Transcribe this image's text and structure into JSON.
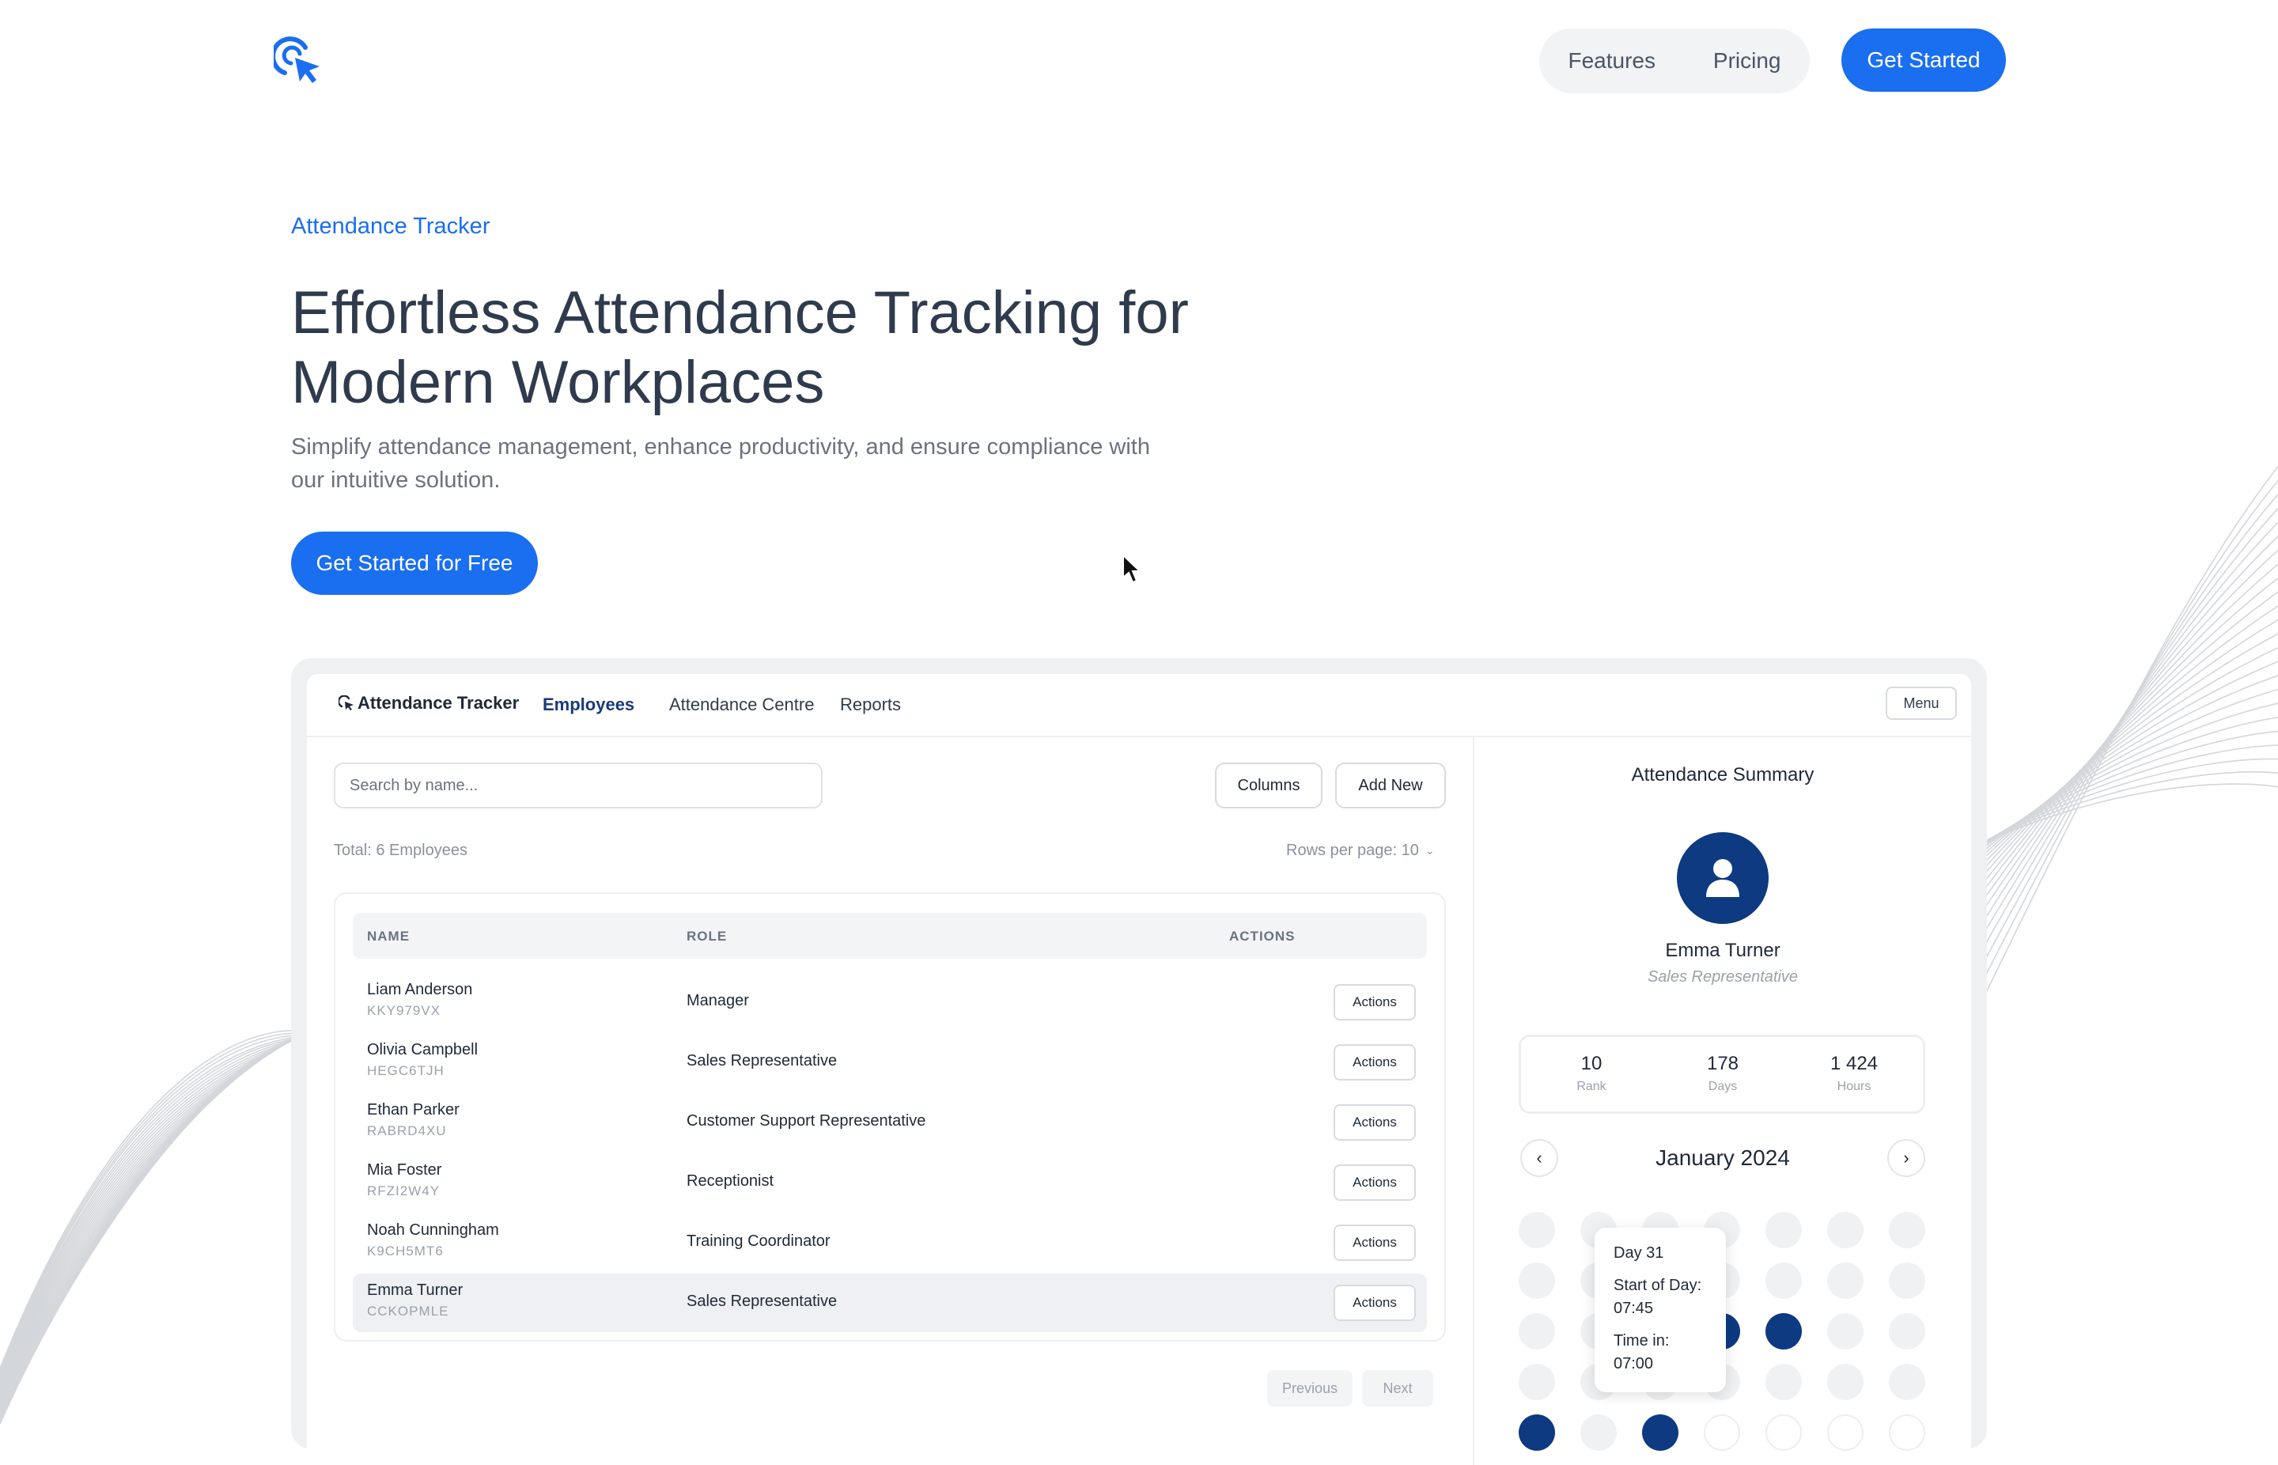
{
  "nav": {
    "links": [
      "Features",
      "Pricing"
    ],
    "cta": "Get Started"
  },
  "hero": {
    "eyebrow": "Attendance Tracker",
    "title_line1": "Effortless Attendance Tracking for",
    "title_line2": "Modern Workplaces",
    "subtitle_line1": "Simplify attendance management, enhance productivity, and ensure compliance with",
    "subtitle_line2": "our intuitive solution.",
    "cta": "Get Started for Free"
  },
  "app": {
    "brand": "Attendance Tracker",
    "tabs": [
      "Employees",
      "Attendance Centre",
      "Reports"
    ],
    "active_tab": "Employees",
    "menu": "Menu",
    "search_placeholder": "Search by name...",
    "columns_button": "Columns",
    "add_new_button": "Add New",
    "total": "Total: 6 Employees",
    "rows_per_page": "Rows per page: 10",
    "table": {
      "headers": [
        "NAME",
        "ROLE",
        "ACTIONS"
      ],
      "action_label": "Actions",
      "rows": [
        {
          "name": "Liam Anderson",
          "id": "KKY979VX",
          "role": "Manager"
        },
        {
          "name": "Olivia Campbell",
          "id": "HEGC6TJH",
          "role": "Sales Representative"
        },
        {
          "name": "Ethan Parker",
          "id": "RABRD4XU",
          "role": "Customer Support Representative"
        },
        {
          "name": "Mia Foster",
          "id": "RFZI2W4Y",
          "role": "Receptionist"
        },
        {
          "name": "Noah Cunningham",
          "id": "K9CH5MT6",
          "role": "Training Coordinator"
        },
        {
          "name": "Emma Turner",
          "id": "CCKOPMLE",
          "role": "Sales Representative"
        }
      ],
      "selected_row": 5
    },
    "pagination": {
      "previous": "Previous",
      "next": "Next"
    }
  },
  "summary": {
    "title": "Attendance Summary",
    "name": "Emma Turner",
    "role": "Sales Representative",
    "stats": [
      {
        "value": "10",
        "label": "Rank"
      },
      {
        "value": "178",
        "label": "Days"
      },
      {
        "value": "1 424",
        "label": "Hours"
      }
    ],
    "month": "January 2024",
    "prev_icon": "chevron-left-icon",
    "next_icon": "chevron-right-icon",
    "calendar_rows": [
      [
        "empty",
        "empty",
        "empty",
        "empty",
        "empty",
        "empty",
        "empty"
      ],
      [
        "empty",
        "empty",
        "empty",
        "empty",
        "empty",
        "empty",
        "empty"
      ],
      [
        "empty",
        "empty",
        "empty",
        "present",
        "present",
        "empty",
        "empty"
      ],
      [
        "empty",
        "empty",
        "empty",
        "empty",
        "empty",
        "empty",
        "empty"
      ],
      [
        "present",
        "empty",
        "present",
        "future",
        "future",
        "future",
        "future"
      ]
    ],
    "tooltip": {
      "day": "Day 31",
      "start_label": "Start of Day:",
      "start_value": "07:45",
      "time_in_label": "Time in:",
      "time_in_value": "07:00"
    }
  },
  "colors": {
    "primary": "#1a6ef0",
    "navy": "#0d3a80",
    "text": "#2f3b4d",
    "muted": "#6b7280"
  }
}
